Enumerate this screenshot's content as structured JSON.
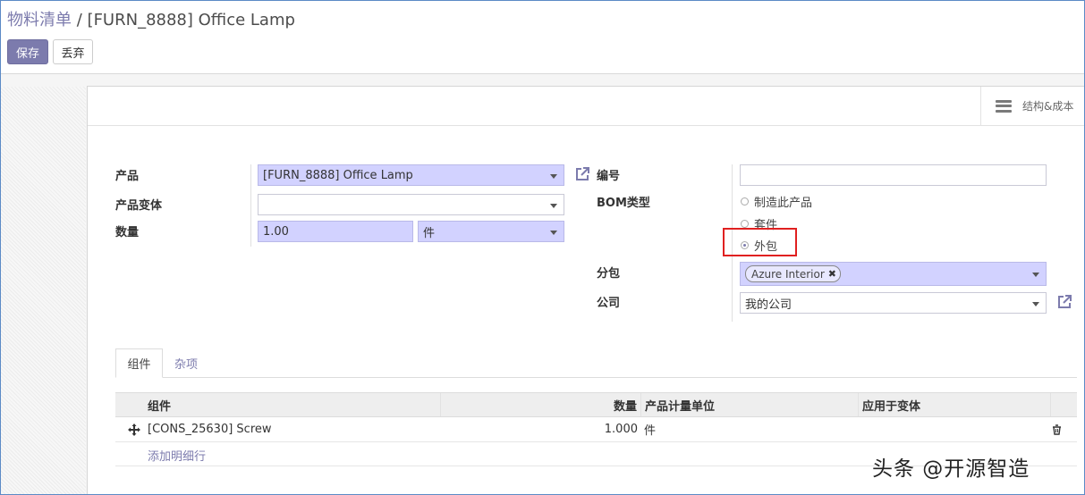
{
  "breadcrumb": {
    "parent": "物料清单",
    "separator": "/",
    "current": "[FURN_8888] Office Lamp"
  },
  "toolbar": {
    "save_label": "保存",
    "discard_label": "丢弃"
  },
  "stat_button": {
    "icon": "bars-icon",
    "label": "结构&成本"
  },
  "form": {
    "product": {
      "label": "产品",
      "value": "[FURN_8888] Office Lamp"
    },
    "product_variant": {
      "label": "产品变体",
      "value": ""
    },
    "quantity": {
      "label": "数量",
      "value": "1.00",
      "uom": "件"
    },
    "code": {
      "label": "编号",
      "value": ""
    },
    "bom_type": {
      "label": "BOM类型",
      "options": [
        "制造此产品",
        "套件",
        "外包"
      ],
      "selected": "外包"
    },
    "subcontractors": {
      "label": "分包",
      "tags": [
        "Azure Interior"
      ]
    },
    "company": {
      "label": "公司",
      "value": "我的公司"
    }
  },
  "tabs": [
    {
      "label": "组件",
      "active": true
    },
    {
      "label": "杂项",
      "active": false
    }
  ],
  "components_table": {
    "columns": [
      "组件",
      "数量",
      "产品计量单位",
      "应用于变体"
    ],
    "rows": [
      {
        "component": "[CONS_25630] Screw",
        "quantity": "1.000",
        "uom": "件",
        "variants": ""
      }
    ],
    "add_line_label": "添加明细行"
  },
  "watermark": "头条 @开源智造",
  "colors": {
    "accent": "#7c7bad",
    "required_field": "#d2d2ff",
    "highlight": "#e02020"
  }
}
